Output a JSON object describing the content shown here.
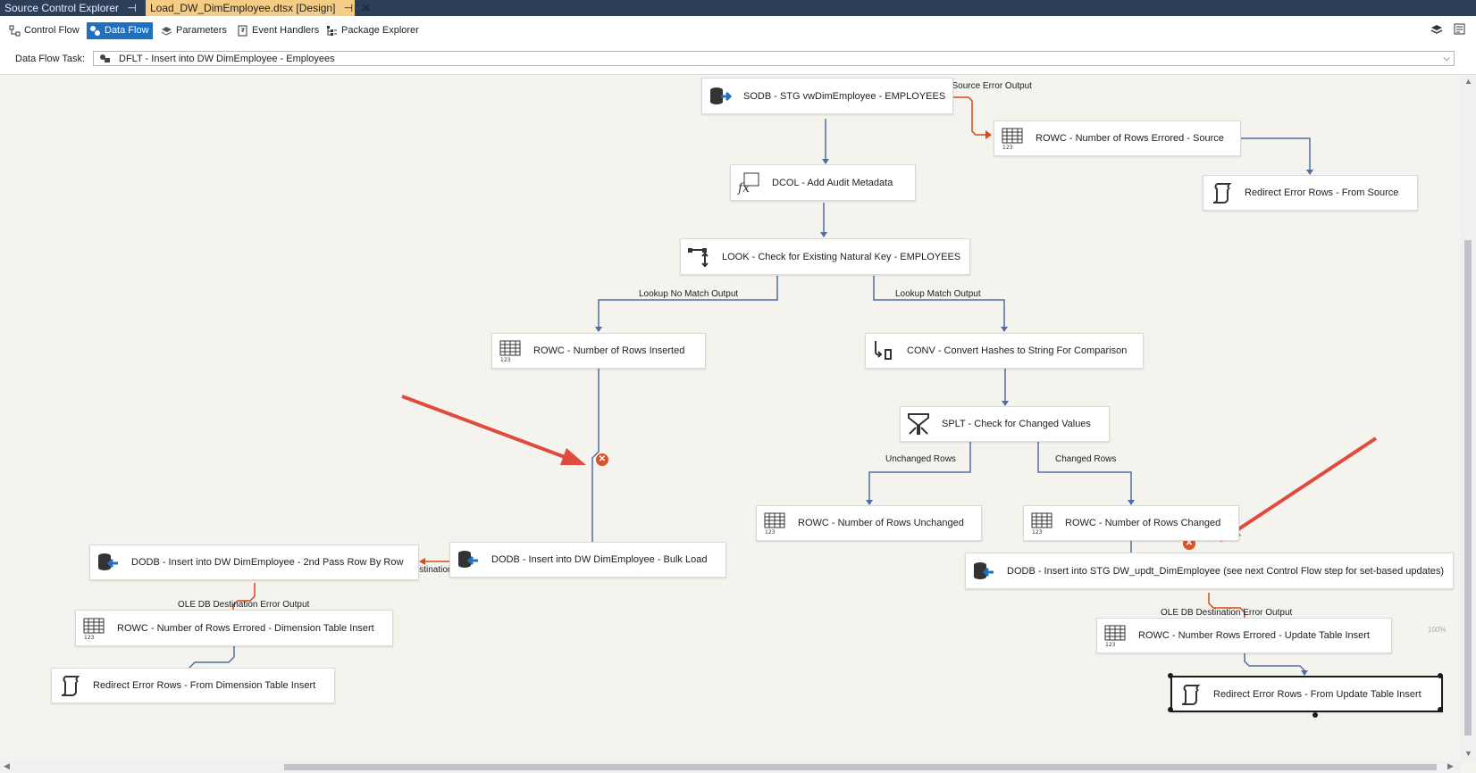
{
  "tabs": {
    "inactive": {
      "label": "Source Control Explorer",
      "pin": "⊣"
    },
    "active": {
      "label": "Load_DW_DimEmployee.dtsx [Design]",
      "pin": "⊣",
      "close": "✕"
    }
  },
  "toolbar": {
    "control_flow": "Control Flow",
    "data_flow": "Data Flow",
    "parameters": "Parameters",
    "event_handlers": "Event Handlers",
    "package_explorer": "Package Explorer"
  },
  "task": {
    "label": "Data Flow Task:",
    "value": "DFLT - Insert into DW DimEmployee - Employees"
  },
  "nodes": {
    "sodb": "SODB - STG vwDimEmployee - EMPLOYEES",
    "rowc_src": "ROWC - Number of Rows Errored - Source",
    "redirect_src": "Redirect Error Rows - From Source",
    "dcol": "DCOL - Add Audit Metadata",
    "look": "LOOK - Check for Existing Natural Key - EMPLOYEES",
    "rowc_ins": "ROWC - Number of Rows Inserted",
    "conv": "CONV - Convert Hashes to String For Comparison",
    "splt": "SPLT - Check for Changed Values",
    "rowc_unch": "ROWC - Number of Rows Unchanged",
    "rowc_chg": "ROWC - Number of Rows Changed",
    "dodb_bulk": "DODB - Insert into DW DimEmployee - Bulk Load",
    "dodb_2nd": "DODB - Insert into DW DimEmployee - 2nd Pass Row By Row",
    "dodb_stg": "DODB - Insert into STG DW_updt_DimEmployee (see next Control Flow step for set-based updates)",
    "rowc_dim": "ROWC - Number of Rows Errored - Dimension Table Insert",
    "redirect_dim": "Redirect Error Rows - From Dimension Table Insert",
    "rowc_upd": "ROWC - Number Rows Errored - Update Table Insert",
    "redirect_upd": "Redirect Error Rows - From Update Table Insert"
  },
  "paths": {
    "ole_src_err": "OLE DB Source Error Output",
    "lookup_no_match": "Lookup No Match Output",
    "lookup_match": "Lookup Match Output",
    "unchanged": "Unchanged Rows",
    "changed": "Changed Rows",
    "ole_dest_err_1": "OLE DB Destination Error Output",
    "ole_dest_err_2": "OLE DB Destination Error Output",
    "ole_dest_err_3": "OLE DB Destination Error Output"
  },
  "markers": {
    "error": "✕"
  },
  "zoom": "100%",
  "colors": {
    "tab_bar": "#2d3e58",
    "active_tab": "#f5cc84",
    "toolbar_active": "#1f70c1",
    "canvas": "#f5f3ee",
    "path_normal": "#4f6f9e",
    "path_error": "#d44a1c",
    "annotation_arrow": "#e04a3f"
  }
}
